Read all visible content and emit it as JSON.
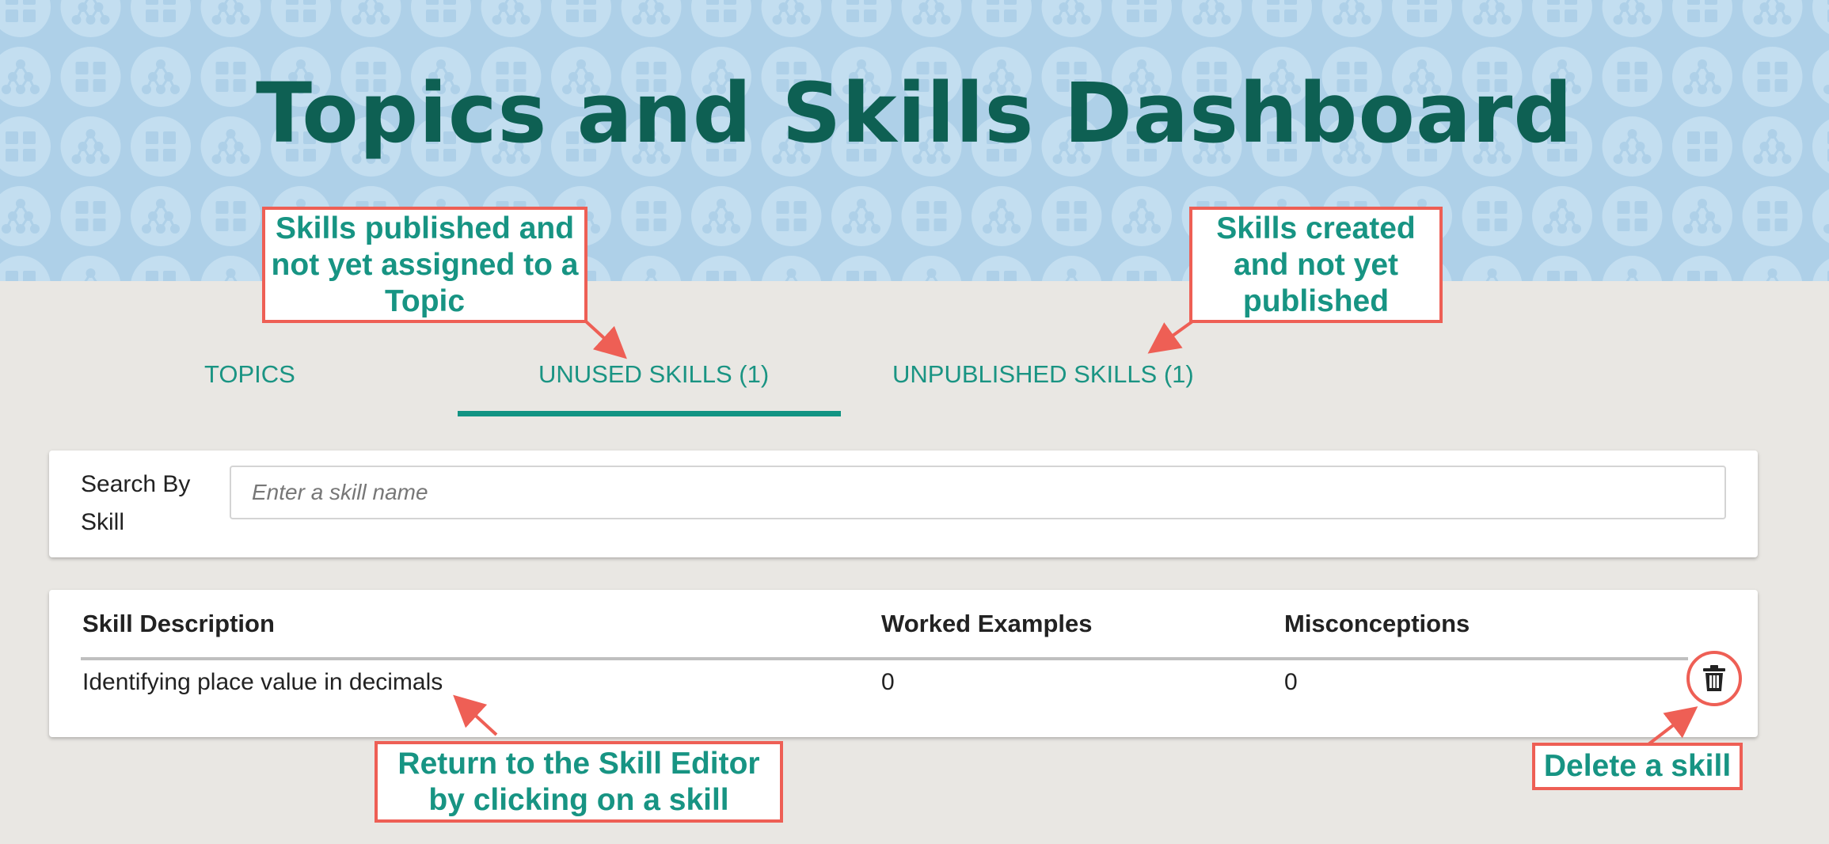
{
  "page": {
    "title": "Topics and Skills Dashboard"
  },
  "colors": {
    "banner_bg": "#aed0e8",
    "title": "#0e6053",
    "accent_teal": "#129483",
    "annotation_red": "#ee5f55",
    "page_bg": "#e9e7e3"
  },
  "tabs": [
    {
      "label": "TOPICS",
      "active": false
    },
    {
      "label": "UNUSED SKILLS (1)",
      "active": true
    },
    {
      "label": "UNPUBLISHED SKILLS (1)",
      "active": false
    }
  ],
  "search": {
    "label": "Search By Skill",
    "placeholder": "Enter a skill name",
    "value": ""
  },
  "table": {
    "headers": [
      "Skill Description",
      "Worked Examples",
      "Misconceptions"
    ],
    "rows": [
      {
        "description": "Identifying place value in decimals",
        "worked_examples": "0",
        "misconceptions": "0",
        "action_icon": "trash-icon"
      }
    ]
  },
  "annotations": {
    "unused_skills": "Skills published  and not yet assigned to a Topic",
    "unpublished_skills": "Skills created and not yet published",
    "return_to_editor": "Return to the Skill Editor by clicking on a skill",
    "delete_skill": "Delete a skill"
  }
}
